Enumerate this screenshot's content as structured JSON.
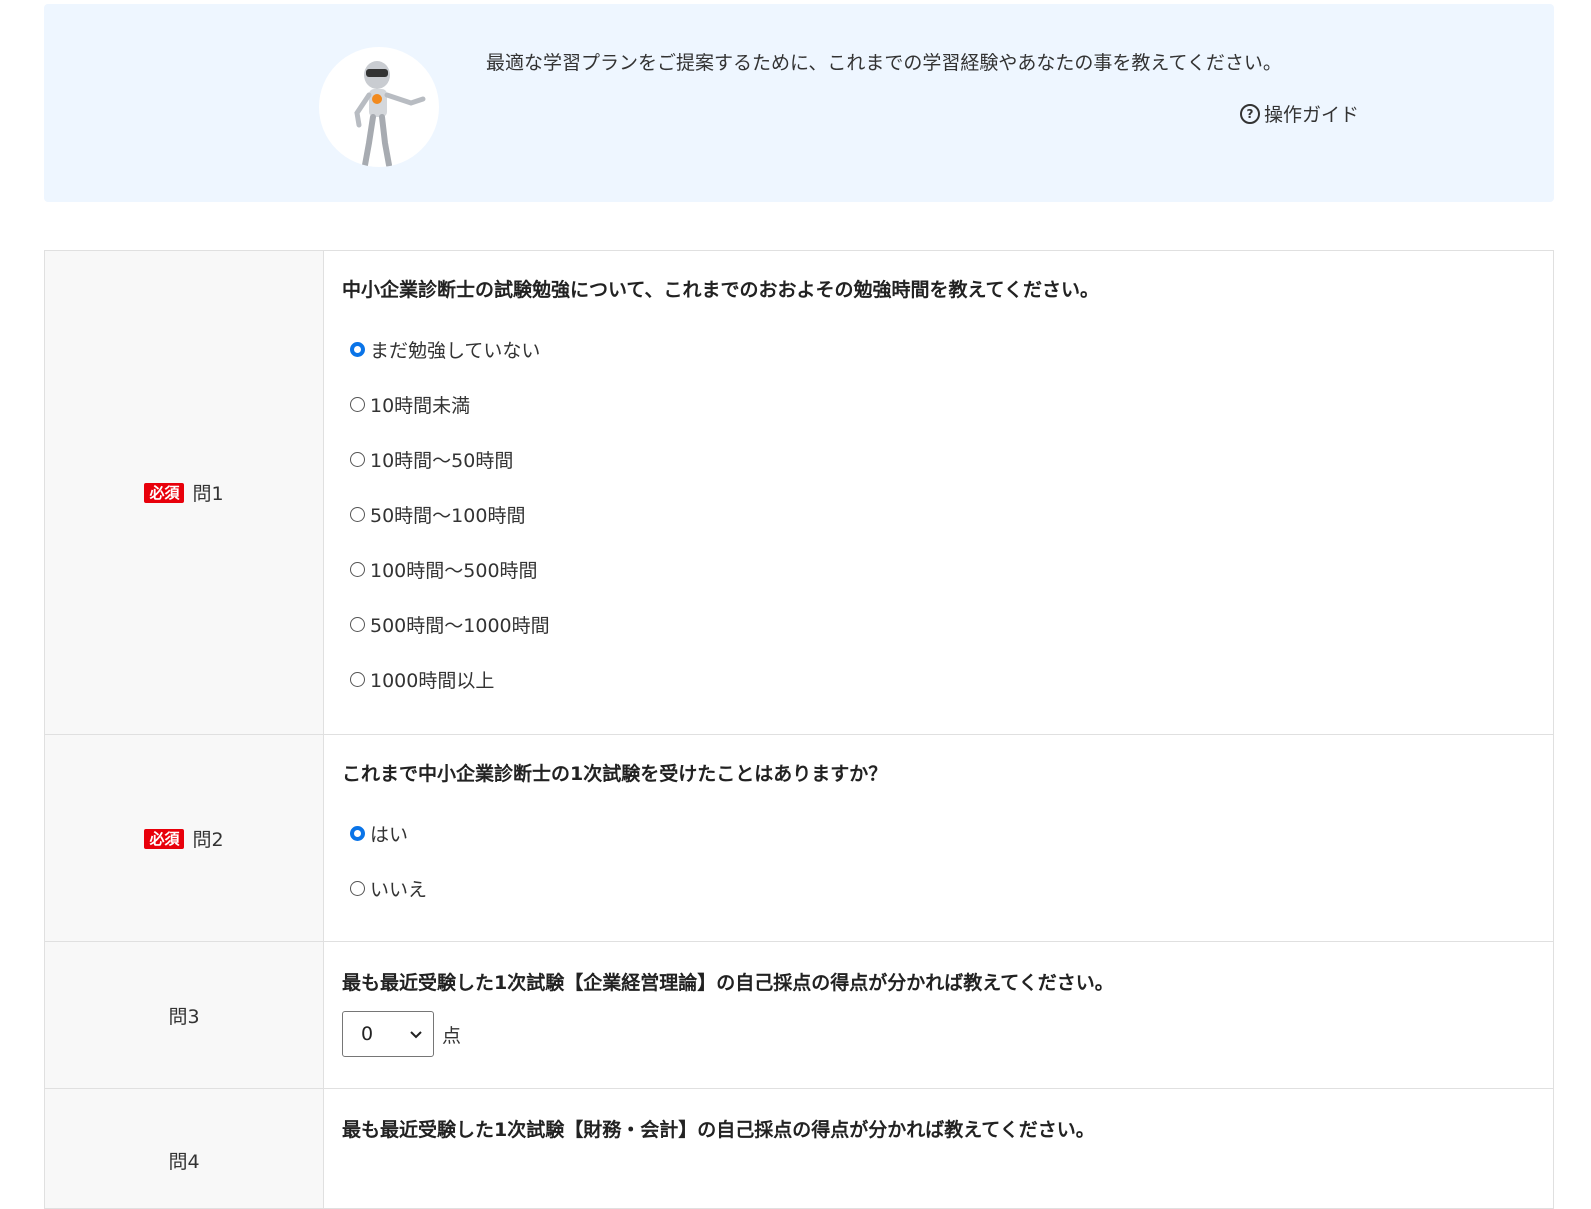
{
  "banner": {
    "intro": "最適な学習プランをご提案するために、これまでの学習経験やあなたの事を教えてください。",
    "guide_label": "操作ガイド",
    "guide_icon": "question-circle-icon"
  },
  "questions": [
    {
      "required_badge": "必須",
      "label": "問1",
      "text": "中小企業診断士の試験勉強について、これまでのおおよその勉強時間を教えてください。",
      "options": [
        "まだ勉強していない",
        "10時間未満",
        "10時間〜50時間",
        "50時間〜100時間",
        "100時間〜500時間",
        "500時間〜1000時間",
        "1000時間以上"
      ],
      "selected": "まだ勉強していない"
    },
    {
      "required_badge": "必須",
      "label": "問2",
      "text": "これまで中小企業診断士の1次試験を受けたことはありますか？",
      "options": [
        "はい",
        "いいえ"
      ],
      "selected": "はい"
    },
    {
      "label": "問3",
      "text": "最も最近受験した1次試験【企業経営理論】の自己採点の得点が分かれば教えてください。",
      "select_value": "0",
      "unit": "点"
    },
    {
      "label": "問4",
      "text": "最も最近受験した1次試験【財務・会計】の自己採点の得点が分かれば教えてください。"
    }
  ],
  "colors": {
    "banner_bg": "#eef6ff",
    "required_badge": "#e8000b",
    "radio_checked": "#0a74e8"
  }
}
